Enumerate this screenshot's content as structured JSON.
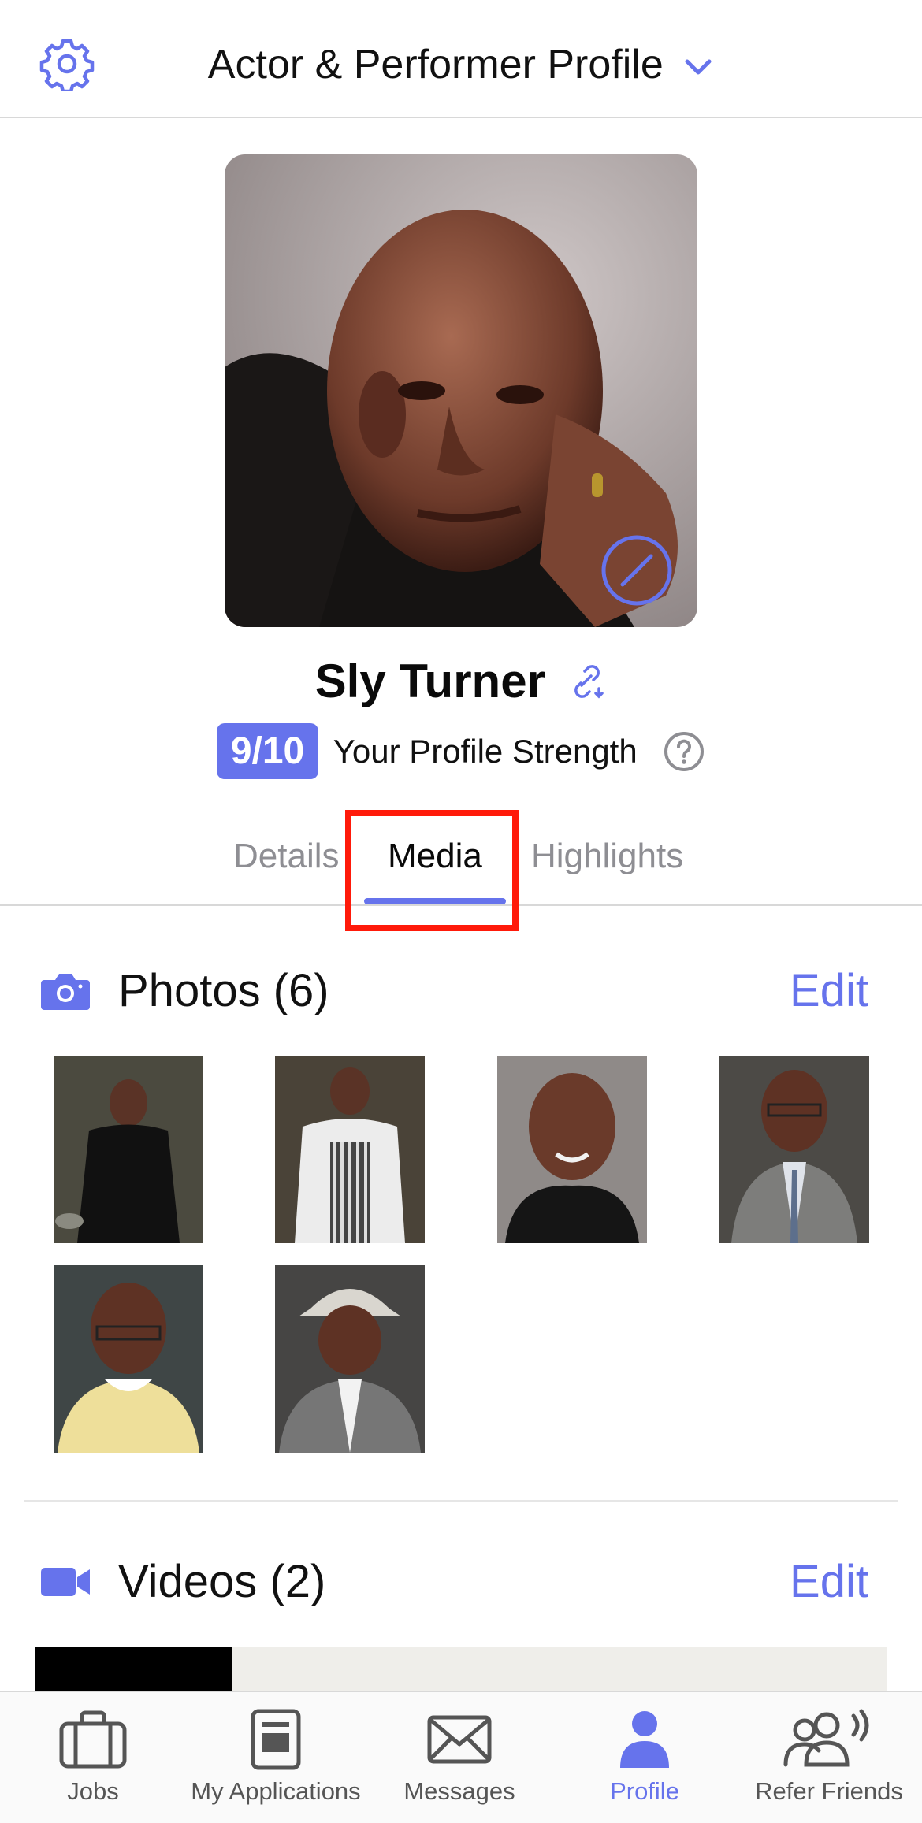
{
  "header": {
    "title": "Actor & Performer Profile"
  },
  "profile": {
    "name": "Sly Turner",
    "strength_score": "9/10",
    "strength_label": "Your Profile Strength"
  },
  "tabs": [
    {
      "label": "Details",
      "active": false
    },
    {
      "label": "Media",
      "active": true
    },
    {
      "label": "Highlights",
      "active": false
    }
  ],
  "photos": {
    "title": "Photos (6)",
    "edit_label": "Edit"
  },
  "videos": {
    "title": "Videos (2)",
    "edit_label": "Edit"
  },
  "bottom_nav": [
    {
      "label": "Jobs",
      "icon": "briefcase-icon",
      "active": false
    },
    {
      "label": "My Applications",
      "icon": "document-icon",
      "active": false
    },
    {
      "label": "Messages",
      "icon": "envelope-icon",
      "active": false
    },
    {
      "label": "Profile",
      "icon": "person-icon",
      "active": true
    },
    {
      "label": "Refer Friends",
      "icon": "refer-friends-icon",
      "active": false
    }
  ],
  "colors": {
    "accent": "#6673ec",
    "highlight_box": "#ff1a0a"
  }
}
